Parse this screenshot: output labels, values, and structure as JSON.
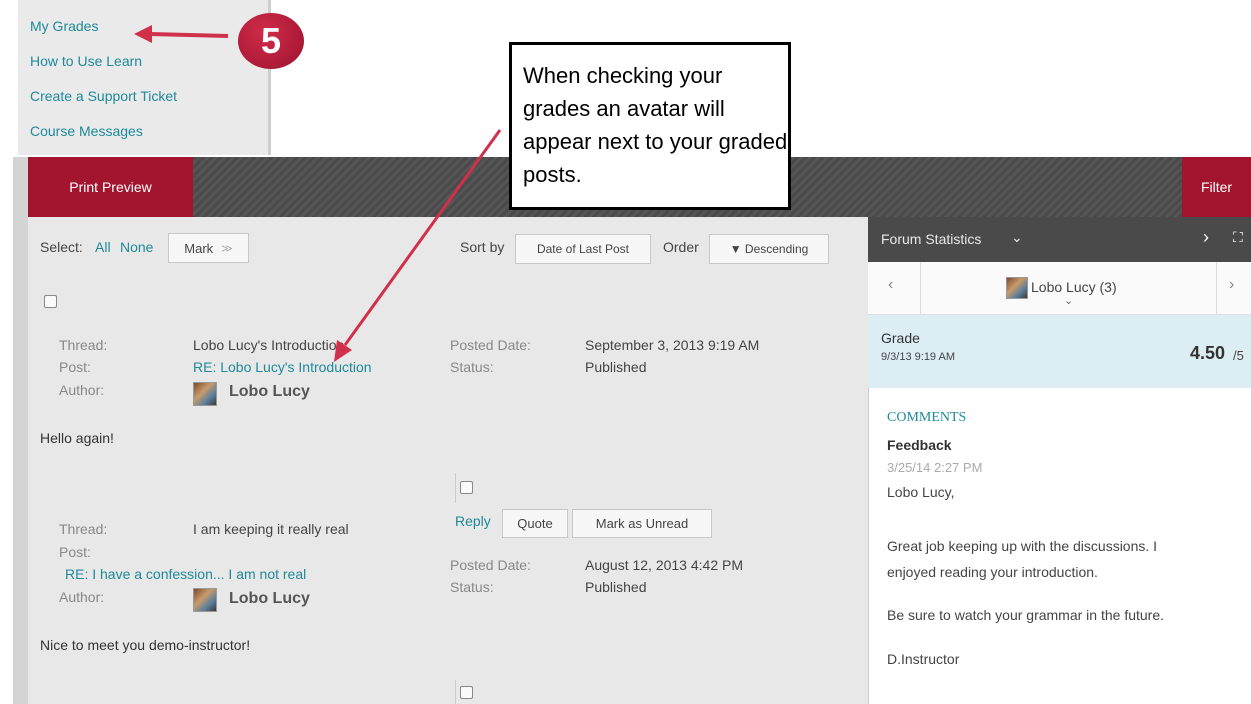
{
  "nav": {
    "items": [
      "My Grades",
      "How to Use Learn",
      "Create a Support Ticket",
      "Course Messages"
    ]
  },
  "callout": {
    "step_number": "5",
    "text": "When checking your grades an avatar will appear next to your graded posts."
  },
  "toolbar": {
    "print_preview": "Print Preview",
    "filter": "Filter"
  },
  "controls": {
    "select_label": "Select:",
    "all": "All",
    "none": "None",
    "mark": "Mark",
    "sort_by_label": "Sort by",
    "sort_by_value": "Date of Last Post",
    "order_label": "Order",
    "order_value": "▼ Descending"
  },
  "labels": {
    "thread": "Thread:",
    "post": "Post:",
    "author": "Author:",
    "posted_date": "Posted Date:",
    "status": "Status:"
  },
  "posts": [
    {
      "thread": "Lobo Lucy's Introduction",
      "post": "RE: Lobo Lucy's Introduction",
      "author": "Lobo Lucy",
      "posted_date": "September 3, 2013 9:19 AM",
      "status": "Published",
      "body": "Hello again!"
    },
    {
      "thread": "I am keeping it really real",
      "post": "RE: I have a confession... I am not real",
      "author": "Lobo Lucy",
      "posted_date": "August 12, 2013 4:42 PM",
      "status": "Published",
      "body": "Nice to meet you demo-instructor!"
    }
  ],
  "post_actions": {
    "reply": "Reply",
    "quote": "Quote",
    "mark_unread": "Mark as Unread"
  },
  "sidebar": {
    "title": "Forum Statistics",
    "user": "Lobo Lucy (3)",
    "grade_label": "Grade",
    "grade_date": "9/3/13 9:19 AM",
    "grade_value": "4.50",
    "grade_max": "/5",
    "comments_heading": "COMMENTS",
    "feedback_label": "Feedback",
    "feedback_date": "3/25/14 2:27 PM",
    "feedback_lines": [
      "Lobo Lucy,",
      "Great job keeping up with the discussions. I",
      "enjoyed reading your introduction.",
      "Be sure to watch your grammar in the future.",
      "D.Instructor"
    ]
  },
  "colors": {
    "accent_red": "#a3142e",
    "link_teal": "#1e8a9a",
    "grade_bg": "#dcedf3"
  }
}
